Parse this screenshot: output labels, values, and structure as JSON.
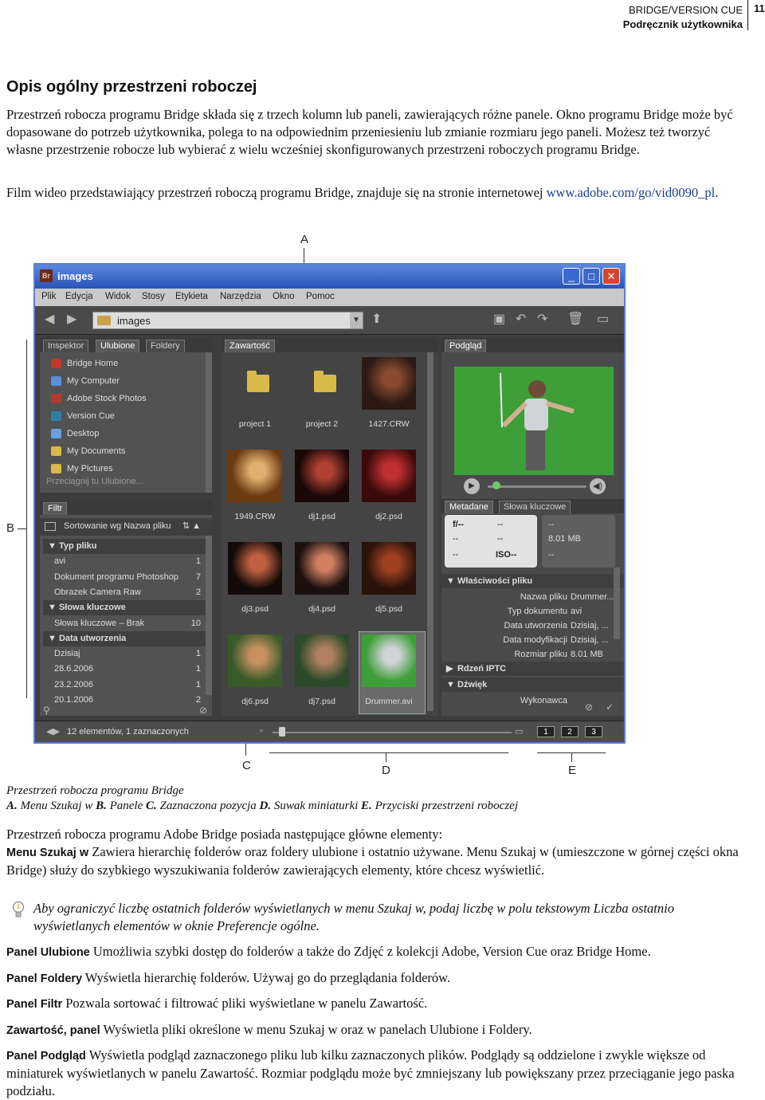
{
  "header": {
    "line1": "BRIDGE/VERSION CUE",
    "line2": "Podręcznik użytkownika",
    "page_number": "11"
  },
  "title": "Opis ogólny przestrzeni roboczej",
  "intro": "Przestrzeń robocza programu Bridge składa się z trzech kolumn lub paneli, zawierających różne panele. Okno programu Bridge może być dopasowane do potrzeb użytkownika, polega to na odpowiednim przeniesieniu lub zmianie rozmiaru jego paneli. Możesz też tworzyć własne przestrzenie robocze lub wybierać z wielu wcześniej skonfigurowanych przestrzeni roboczych programu Bridge.",
  "video_text": "Film wideo przedstawiający przestrzeń roboczą programu Bridge, znajduje się na stronie internetowej",
  "video_link": "www.adobe.com/go/vid0090_pl",
  "video_end": ".",
  "figure": {
    "callouts": {
      "a": "A",
      "b": "B",
      "c": "C",
      "d": "D",
      "e": "E"
    },
    "window": {
      "title": "images",
      "menu": [
        "Plik",
        "Edycja",
        "Widok",
        "Stosy",
        "Etykieta",
        "Narzędzia",
        "Okno",
        "Pomoc"
      ],
      "path": "images",
      "left_tabs": [
        "Inspektor",
        "Ulubione",
        "Foldery"
      ],
      "favorites": [
        {
          "label": "Bridge Home",
          "color": "#c0392b"
        },
        {
          "label": "My Computer",
          "color": "#5b8fd6"
        },
        {
          "label": "Adobe Stock Photos",
          "color": "#b03a2e"
        },
        {
          "label": "Version Cue",
          "color": "#2e7fa8"
        },
        {
          "label": "Desktop",
          "color": "#6aa0e0"
        },
        {
          "label": "My Documents",
          "color": "#d8b94a"
        },
        {
          "label": "My Pictures",
          "color": "#d8b94a"
        }
      ],
      "favorites_hint": "Przeciągnij tu Ulubione...",
      "filter_tab": "Filtr",
      "sort_label": "Sortowanie wg Nazwa pliku",
      "filter_rows": [
        {
          "label": "Typ pliku",
          "count": "",
          "header": true
        },
        {
          "label": "avi",
          "count": "1",
          "header": false
        },
        {
          "label": "Dokument programu Photoshop",
          "count": "7",
          "header": false
        },
        {
          "label": "Obrazek Camera Raw",
          "count": "2",
          "header": false
        },
        {
          "label": "Słowa kluczowe",
          "count": "",
          "header": true
        },
        {
          "label": "Słowa kluczowe – Brak",
          "count": "10",
          "header": false
        },
        {
          "label": "Data utworzenia",
          "count": "",
          "header": true
        },
        {
          "label": "Dzisiaj",
          "count": "1",
          "header": false
        },
        {
          "label": "28.6.2006",
          "count": "1",
          "header": false
        },
        {
          "label": "23.2.2006",
          "count": "1",
          "header": false
        },
        {
          "label": "20.1.2006",
          "count": "2",
          "header": false
        }
      ],
      "content_tab": "Zawartość",
      "thumbs": [
        "project 1",
        "project 2",
        "1427.CRW",
        "1949.CRW",
        "dj1.psd",
        "dj2.psd",
        "dj3.psd",
        "dj4.psd",
        "dj5.psd",
        "dj6.psd",
        "dj7.psd",
        "Drummer.avi"
      ],
      "preview_tab": "Podgląd",
      "meta_tabs": [
        "Metadane",
        "Słowa kluczowe"
      ],
      "meta_block": {
        "aperture": "f/--",
        "c1": "--",
        "c2": "--",
        "c3": "--",
        "c4": "--",
        "iso": "ISO--",
        "size": "8.01 MB",
        "r1": "--",
        "r3": "--"
      },
      "file_props_header": "Właściwości pliku",
      "file_props": [
        {
          "k": "Nazwa pliku",
          "v": "Drummer..."
        },
        {
          "k": "Typ dokumentu",
          "v": "avi"
        },
        {
          "k": "Data utworzenia",
          "v": "Dzisiaj, ..."
        },
        {
          "k": "Data modyfikacji",
          "v": "Dzisiaj, ..."
        },
        {
          "k": "Rozmiar pliku",
          "v": "8.01 MB"
        }
      ],
      "iptc_header": "Rdzeń IPTC",
      "audio_header": "Dźwięk",
      "audio_row": "Wykonawca",
      "status": "12 elementów, 1 zaznaczonych",
      "ws_buttons": [
        "1",
        "2",
        "3"
      ]
    }
  },
  "caption": {
    "line1": "Przestrzeń robocza programu Bridge",
    "items": [
      {
        "letter": "A.",
        "text": "Menu Szukaj w"
      },
      {
        "letter": "B.",
        "text": "Panele"
      },
      {
        "letter": "C.",
        "text": "Zaznaczona pozycja"
      },
      {
        "letter": "D.",
        "text": "Suwak miniaturki"
      },
      {
        "letter": "E.",
        "text": "Przyciski przestrzeni roboczej"
      }
    ]
  },
  "elements_intro": "Przestrzeń robocza programu Adobe Bridge posiada następujące główne elementy:",
  "szukaj": {
    "term": "Menu Szukaj w",
    "desc": "Zawiera hierarchię folderów oraz foldery ulubione i ostatnio używane. Menu Szukaj w (umieszczone w górnej części okna Bridge) służy do szybkiego wyszukiwania folderów zawierających elementy, które chcesz wyświetlić."
  },
  "tip": "Aby ograniczyć liczbę ostatnich folderów wyświetlanych w menu Szukaj w, podaj liczbę w polu tekstowym Liczba ostatnio wyświetlanych elementów w oknie Preferencje ogólne.",
  "defs": [
    {
      "term": "Panel Ulubione",
      "desc": "Umożliwia szybki dostęp do folderów a także do Zdjęć z kolekcji Adobe, Version Cue oraz Bridge Home."
    },
    {
      "term": "Panel Foldery",
      "desc": "Wyświetla hierarchię folderów. Używaj go do przeglądania folderów."
    },
    {
      "term": "Panel Filtr",
      "desc": "Pozwala sortować i filtrować pliki wyświetlane w panelu Zawartość."
    },
    {
      "term": "Zawartość, panel",
      "desc": "Wyświetla pliki określone w menu Szukaj w oraz w panelach Ulubione i Foldery."
    },
    {
      "term": "Panel Podgląd",
      "desc": "Wyświetla podgląd zaznaczonego pliku lub kilku zaznaczonych plików. Podglądy są oddzielone i zwykle większe od miniaturek wyświetlanych w panelu Zawartość. Rozmiar podglądu może być zmniejszany lub powiększany przez przeciąganie jego paska podziału."
    }
  ]
}
